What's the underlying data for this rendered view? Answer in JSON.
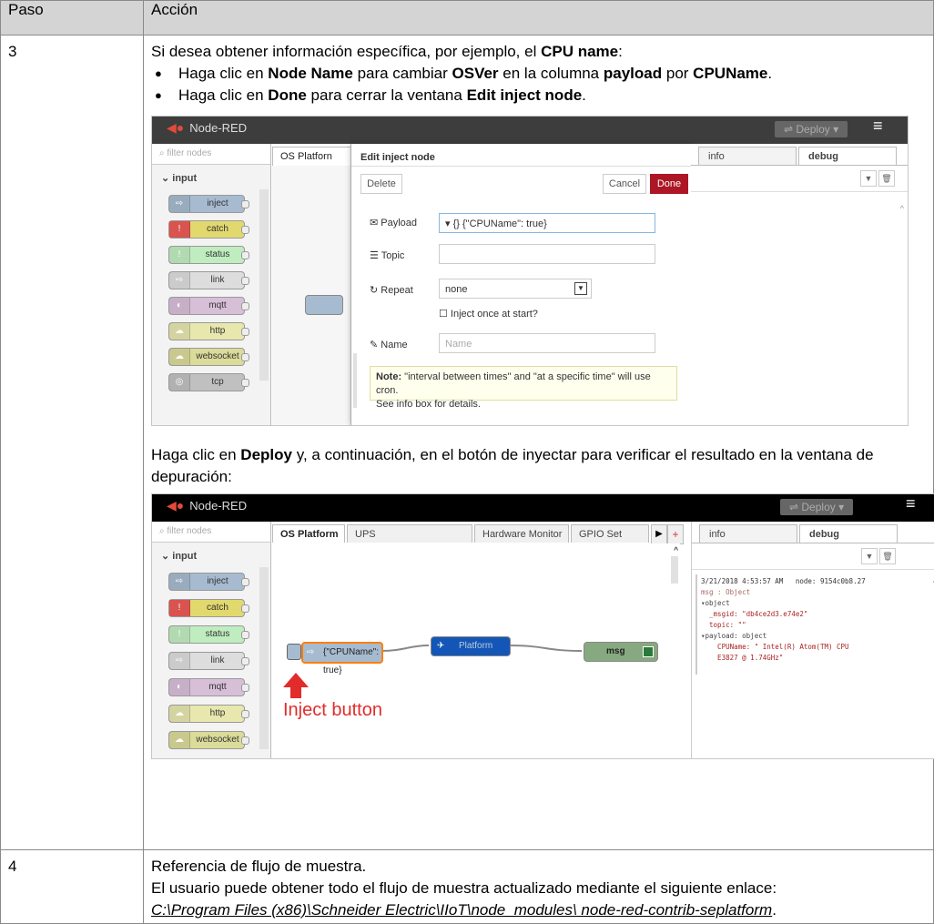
{
  "table": {
    "col_step": "Paso",
    "col_action": "Acción"
  },
  "row3": {
    "step": "3",
    "intro": "Si desea obtener información específica, por ejemplo, el",
    "intro_b": "CPU name",
    "intro_end": ":",
    "bullet1": {
      "t1": "Haga clic en",
      "b1": "Node Name",
      "t2": "para cambiar",
      "b2": "OSVer",
      "t3": "en la columna",
      "b3": "payload",
      "t4": "por",
      "b4": "CPUName",
      "t5": "."
    },
    "bullet2": {
      "t1": "Haga clic en",
      "b1": "Done",
      "t2": "para cerrar la ventana",
      "b2": "Edit inject node",
      "t3": "."
    },
    "deploy_text": {
      "t1": "Haga clic en",
      "b1": "Deploy",
      "t2": "y, a continuación, en el botón de inyectar para verificar el resultado en la ventana de depuración:"
    }
  },
  "shot1": {
    "app_title": "Node-RED",
    "deploy": "Deploy",
    "filter_placeholder": "filter nodes",
    "category": "input",
    "palette": [
      "inject",
      "catch",
      "status",
      "link",
      "mqtt",
      "http",
      "websocket",
      "tcp"
    ],
    "tab": "OS Platforn",
    "dialog_title": "Edit inject node",
    "delete": "Delete",
    "cancel": "Cancel",
    "done": "Done",
    "payload_label": "Payload",
    "payload_value": "{\"CPUName\": true}",
    "payload_type": "{}",
    "topic_label": "Topic",
    "repeat_label": "Repeat",
    "repeat_value": "none",
    "inject_once": "Inject once at start?",
    "name_label": "Name",
    "name_placeholder": "Name",
    "note_bold": "Note:",
    "note_text": "\"interval between times\" and \"at a specific time\" will use cron.",
    "note_text2": "See info box for details.",
    "side_info": "info",
    "side_debug": "debug"
  },
  "shot2": {
    "app_title": "Node-RED",
    "deploy": "Deploy",
    "filter_placeholder": "filter nodes",
    "category": "input",
    "palette": [
      "inject",
      "catch",
      "status",
      "link",
      "mqtt",
      "http",
      "websocket"
    ],
    "tabs": [
      "OS Platform",
      "UPS",
      "Hardware Monitor",
      "GPIO Set"
    ],
    "side_info": "info",
    "side_debug": "debug",
    "node_inject": "{\"CPUName\": true}",
    "node_platform": "Platform",
    "node_msg": "msg",
    "inject_caption": "Inject button",
    "debug_lines": [
      "3/21/2018 4:53:57 AM   node: 9154c0b8.27",
      "msg : Object",
      "▾object",
      "  _msgid: \"db4ce2d3.e74e2\"",
      "  topic: \"\"",
      "▾payload: object",
      "    CPUName: \" Intel(R) Atom(TM) CPU",
      "    E3827 @ 1.74GHz\""
    ]
  },
  "row4": {
    "step": "4",
    "line1": "Referencia de flujo de muestra.",
    "line2": "El usuario puede obtener todo el flujo de muestra actualizado mediante el siguiente enlace:",
    "link": "C:\\Program Files (x86)\\Schneider Electric\\IIoT\\node_modules\\ node-red-contrib-seplatform",
    "link_end": "."
  },
  "colors": {
    "header_bg": "#d4d4d4",
    "nr_header": "#3d3d3d",
    "done_button": "#ad1625",
    "inject_arrow": "#e22b2b"
  }
}
